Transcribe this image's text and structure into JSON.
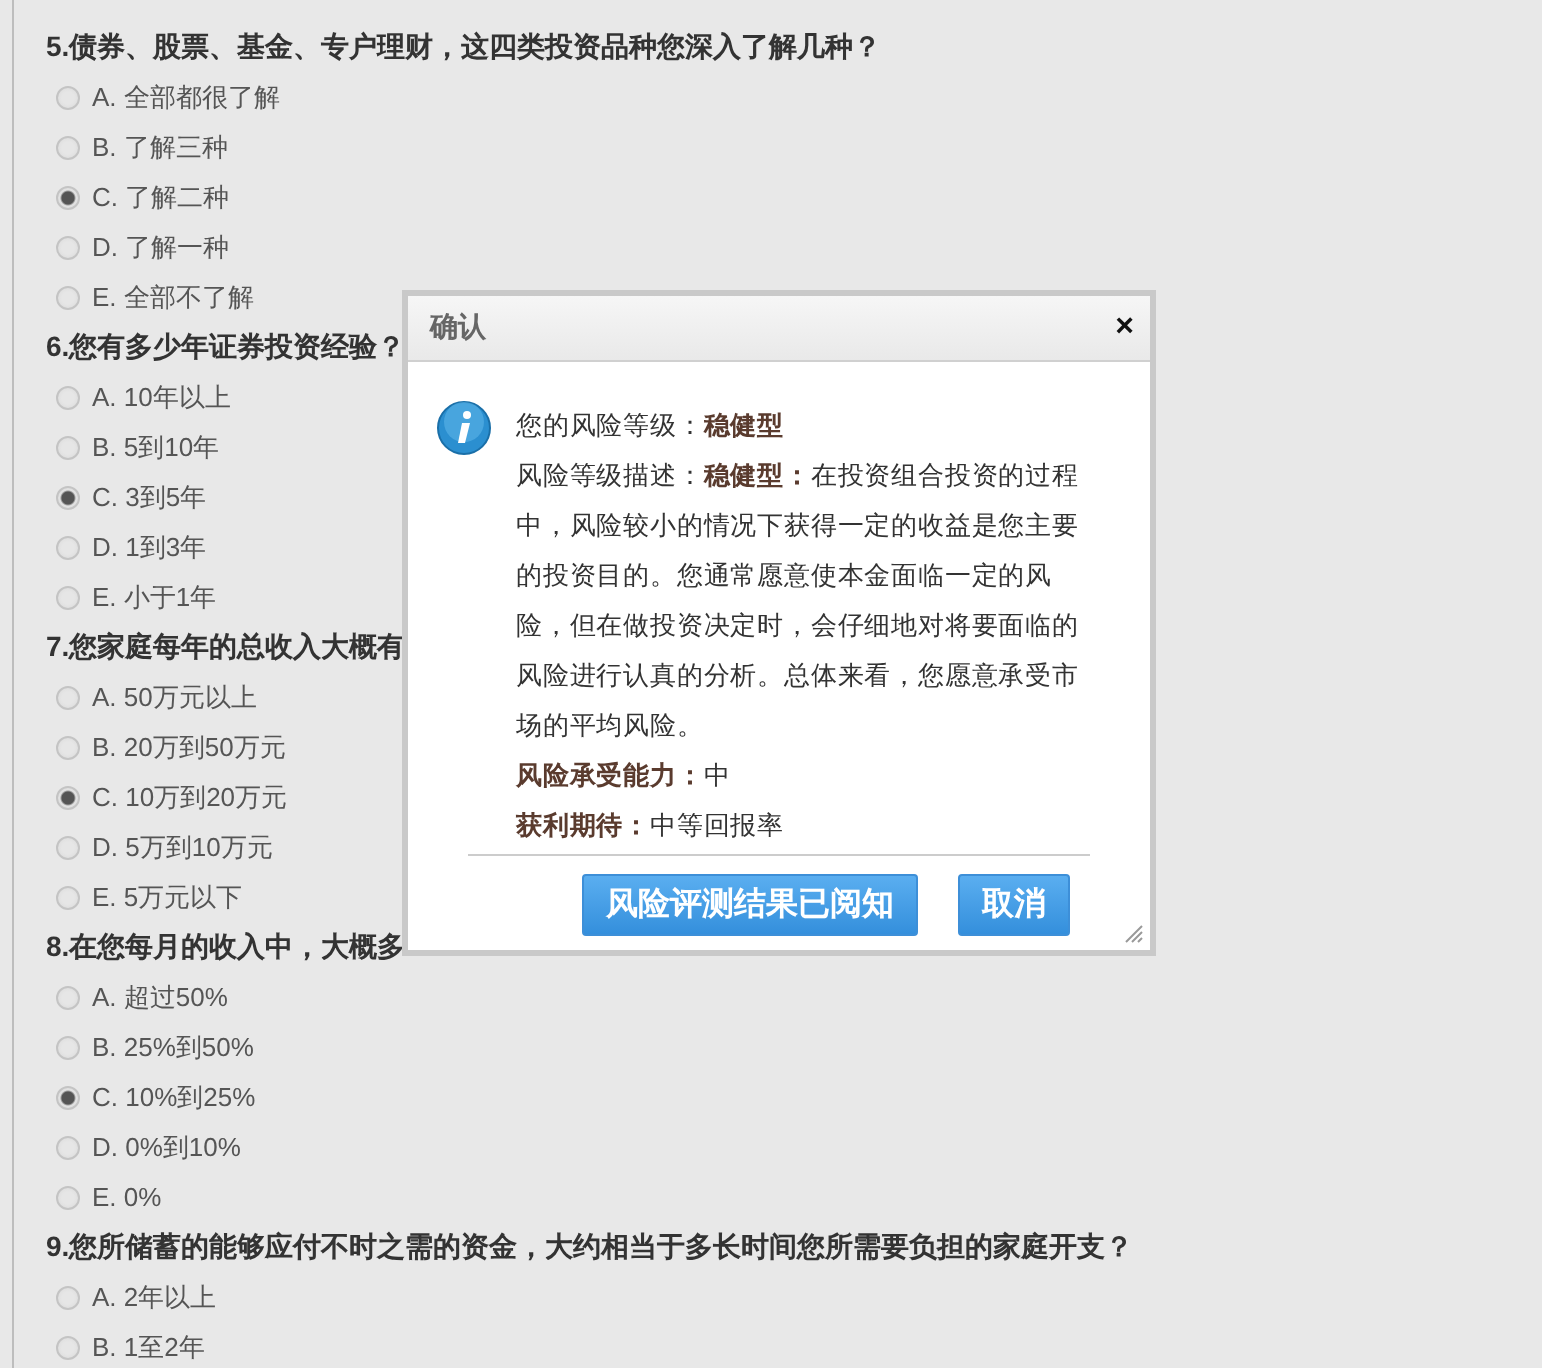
{
  "questions": [
    {
      "title": "5.债券、股票、基金、专户理财，这四类投资品种您深入了解几种？",
      "options": [
        {
          "label": "A. 全部都很了解",
          "selected": false
        },
        {
          "label": "B. 了解三种",
          "selected": false
        },
        {
          "label": "C. 了解二种",
          "selected": true
        },
        {
          "label": "D. 了解一种",
          "selected": false
        },
        {
          "label": "E. 全部不了解",
          "selected": false
        }
      ]
    },
    {
      "title": "6.您有多少年证券投资经验？",
      "options": [
        {
          "label": "A. 10年以上",
          "selected": false
        },
        {
          "label": "B. 5到10年",
          "selected": false
        },
        {
          "label": "C. 3到5年",
          "selected": true
        },
        {
          "label": "D. 1到3年",
          "selected": false
        },
        {
          "label": "E. 小于1年",
          "selected": false
        }
      ]
    },
    {
      "title": "7.您家庭每年的总收入大概有",
      "options": [
        {
          "label": "A. 50万元以上",
          "selected": false
        },
        {
          "label": "B. 20万到50万元",
          "selected": false
        },
        {
          "label": "C. 10万到20万元",
          "selected": true
        },
        {
          "label": "D. 5万到10万元",
          "selected": false
        },
        {
          "label": "E. 5万元以下",
          "selected": false
        }
      ]
    },
    {
      "title": "8.在您每月的收入中，大概多",
      "options": [
        {
          "label": "A. 超过50%",
          "selected": false
        },
        {
          "label": "B. 25%到50%",
          "selected": false
        },
        {
          "label": "C. 10%到25%",
          "selected": true
        },
        {
          "label": "D. 0%到10%",
          "selected": false
        },
        {
          "label": "E. 0%",
          "selected": false
        }
      ]
    },
    {
      "title": "9.您所储蓄的能够应付不时之需的资金，大约相当于多长时间您所需要负担的家庭开支？",
      "options": [
        {
          "label": "A. 2年以上",
          "selected": false
        },
        {
          "label": "B. 1至2年",
          "selected": false
        }
      ]
    }
  ],
  "dialog": {
    "title": "确认",
    "close": "×",
    "lines": [
      {
        "label": "您的风险等级：",
        "value": "稳健型",
        "kind": "bold-value"
      },
      {
        "label": "风险等级描述：",
        "value": "**稳健型：**在投资组合投资的过程中，风险较小的情况下获得一定的收益是您主要的投资目的。您通常愿意使本金面临一定的风险，但在做投资决定时，会仔细地对将要面临的风险进行认真的分析。总体来看，您愿意承受市场的平均风险。",
        "kind": "paragraph"
      },
      {
        "label": "风险承受能力：",
        "value": "中",
        "kind": "plain-value"
      },
      {
        "label": "获利期待：",
        "value": "中等回报率",
        "kind": "plain-value"
      }
    ],
    "buttons": [
      "风险评测结果已阅知",
      "取消"
    ]
  }
}
